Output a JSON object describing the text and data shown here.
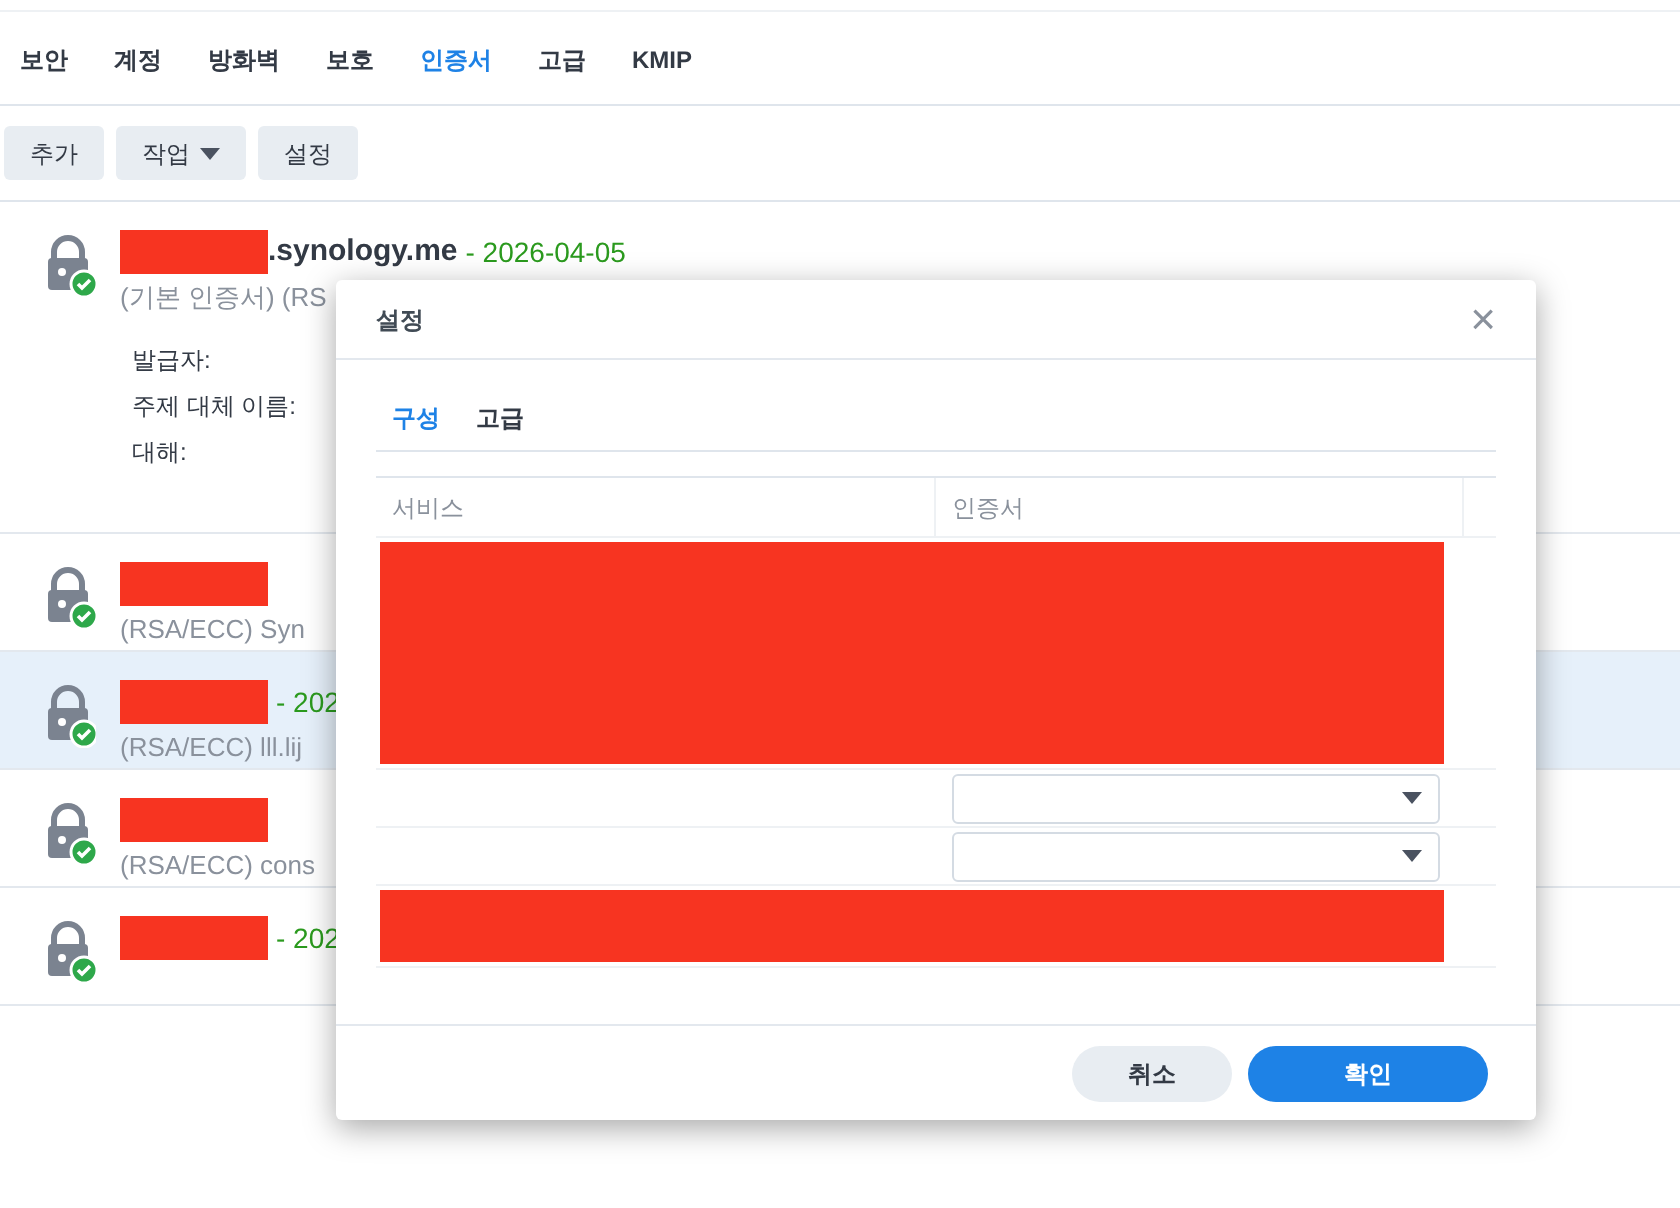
{
  "tabs": [
    {
      "label": "보안",
      "selected": false
    },
    {
      "label": "계정",
      "selected": false
    },
    {
      "label": "방화벽",
      "selected": false
    },
    {
      "label": "보호",
      "selected": false
    },
    {
      "label": "인증서",
      "selected": true
    },
    {
      "label": "고급",
      "selected": false
    },
    {
      "label": "KMIP",
      "selected": false
    }
  ],
  "toolbar": [
    {
      "label": "추가",
      "kind": "button"
    },
    {
      "label": "작업",
      "kind": "dropdown"
    },
    {
      "label": "설정",
      "kind": "button"
    }
  ],
  "certificates": [
    {
      "redacted": true,
      "name": ".synology.me",
      "date": "- 2026-04-05",
      "subtitle": "(기본 인증서) (RS",
      "selected": false,
      "details": [
        "발급자:",
        "주제 대체 이름:",
        "대해:"
      ]
    },
    {
      "redacted": true,
      "subtitle": "(RSA/ECC) Syn",
      "selected": false
    },
    {
      "redacted": true,
      "date": "- 202",
      "subtitle": "(RSA/ECC) lll.lij",
      "selected": true
    },
    {
      "redacted": true,
      "subtitle": "(RSA/ECC) cons",
      "selected": false
    },
    {
      "redacted": true,
      "date": "- 202",
      "selected": false
    }
  ],
  "dialog": {
    "title": "설정",
    "close": "×",
    "tabs": [
      {
        "label": "구성",
        "selected": true
      },
      {
        "label": "고급",
        "selected": false
      }
    ],
    "columns": [
      "서비스",
      "인증서"
    ],
    "rows": [
      {
        "kind": "redacted"
      },
      {
        "kind": "redacted"
      },
      {
        "kind": "redacted"
      },
      {
        "kind": "redacted"
      },
      {
        "kind": "select"
      },
      {
        "kind": "select"
      },
      {
        "kind": "redacted"
      }
    ],
    "buttons": [
      {
        "label": "취소",
        "kind": "secondary"
      },
      {
        "label": "확인",
        "kind": "primary"
      }
    ]
  }
}
